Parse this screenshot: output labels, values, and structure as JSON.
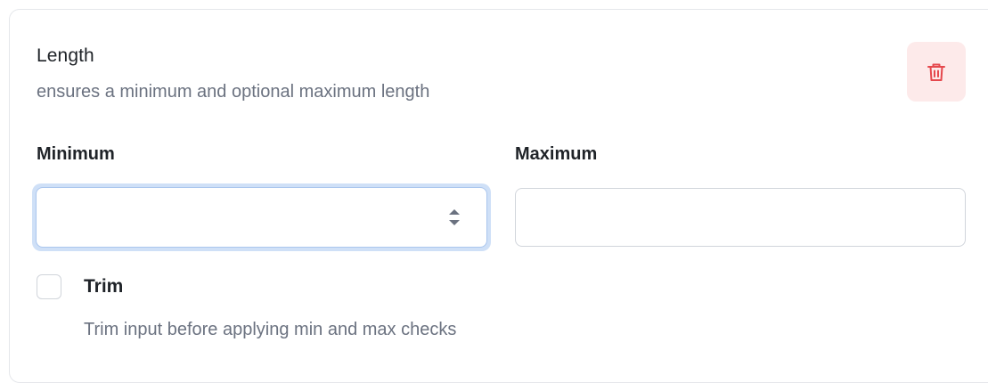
{
  "validator": {
    "title": "Length",
    "description": "ensures a minimum and optional maximum length",
    "delete_icon": "trash-icon",
    "colors": {
      "delete_bg": "#fdeaea",
      "delete_icon": "#e5484d",
      "focus_ring": "#cfe0f7"
    }
  },
  "fields": {
    "minimum": {
      "label": "Minimum",
      "value": "",
      "placeholder": ""
    },
    "maximum": {
      "label": "Maximum",
      "value": "",
      "placeholder": ""
    }
  },
  "trim": {
    "label": "Trim",
    "help": "Trim input before applying min and max checks",
    "checked": false
  }
}
